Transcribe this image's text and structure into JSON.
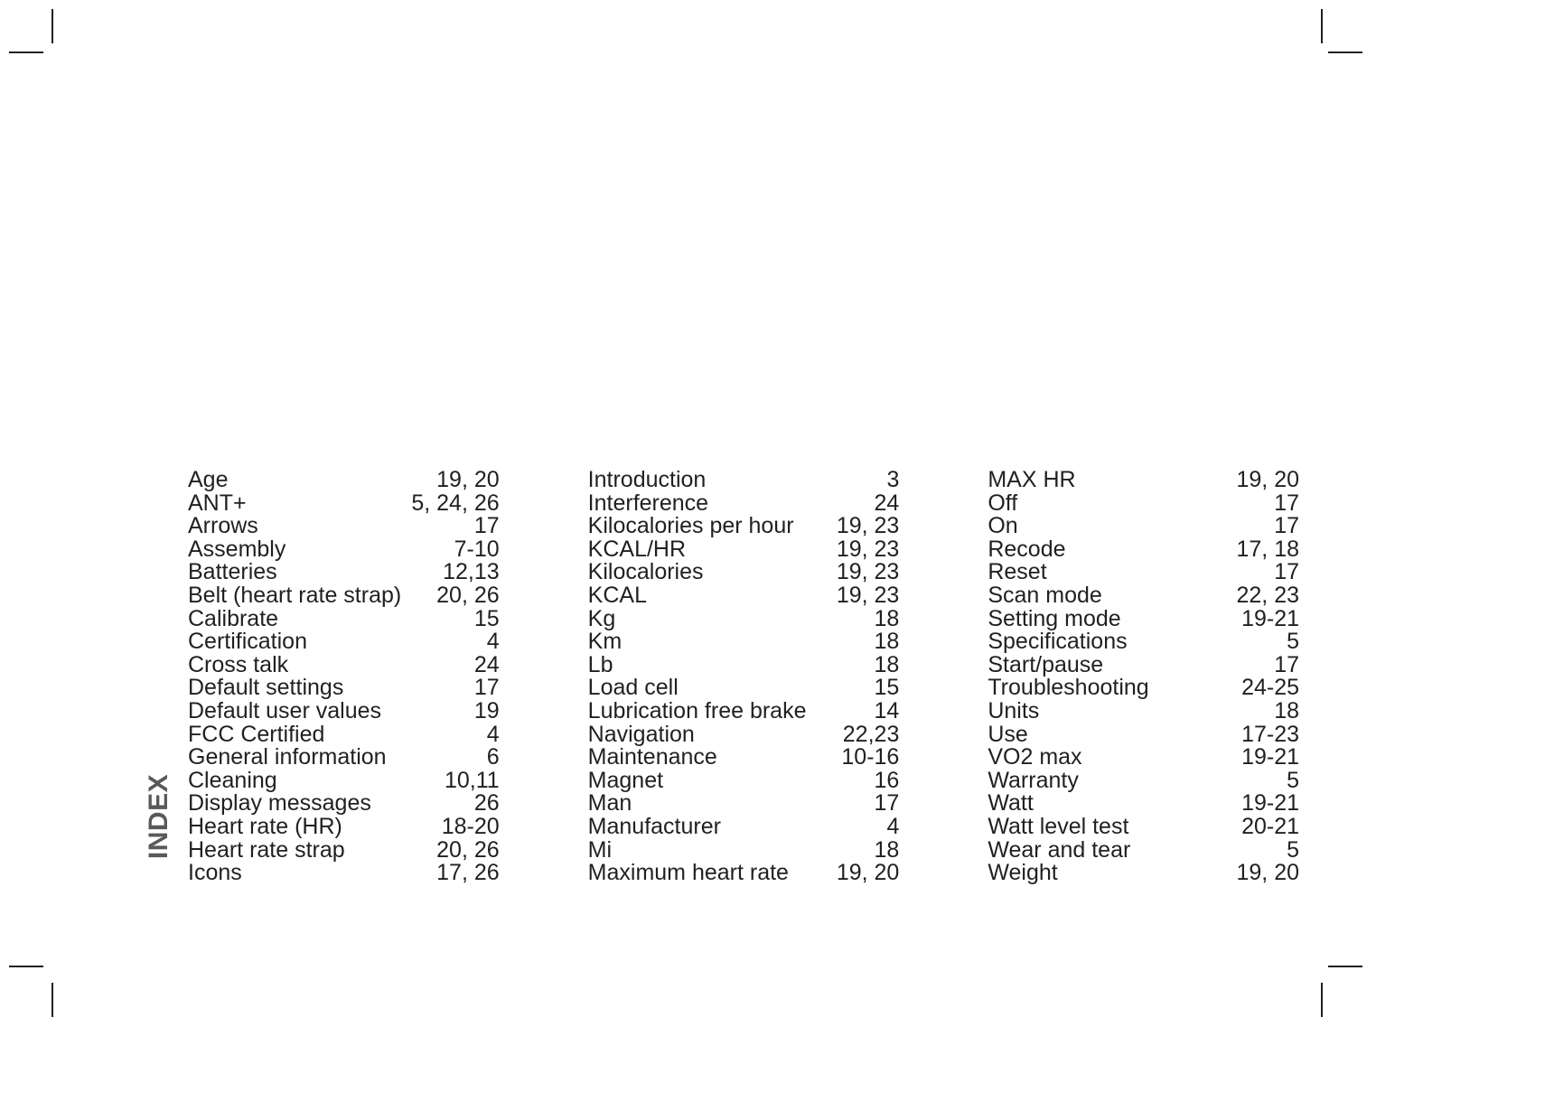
{
  "page": {
    "section_label": "INDEX",
    "section_label_color": "#58595b",
    "text_color": "#231f20",
    "background": "#ffffff"
  },
  "index": {
    "columns": [
      {
        "id": "column-1",
        "entries": [
          {
            "term": "Age",
            "pages": "19, 20"
          },
          {
            "term": "ANT+",
            "pages": "5, 24, 26"
          },
          {
            "term": "Arrows",
            "pages": "17"
          },
          {
            "term": "Assembly",
            "pages": "7-10"
          },
          {
            "term": "Batteries",
            "pages": "12,13"
          },
          {
            "term": "Belt (heart rate strap)",
            "pages": "20, 26"
          },
          {
            "term": "Calibrate",
            "pages": "15"
          },
          {
            "term": "Certification",
            "pages": "4"
          },
          {
            "term": "Cross talk",
            "pages": "24"
          },
          {
            "term": "Default settings",
            "pages": "17"
          },
          {
            "term": "Default user values",
            "pages": "19"
          },
          {
            "term": "FCC Certified",
            "pages": "4"
          },
          {
            "term": "General information",
            "pages": "6"
          },
          {
            "term": "Cleaning",
            "pages": "10,11"
          },
          {
            "term": "Display messages",
            "pages": "26"
          },
          {
            "term": "Heart rate (HR)",
            "pages": "18-20"
          },
          {
            "term": "Heart rate strap",
            "pages": "20, 26"
          },
          {
            "term": "Icons",
            "pages": "17, 26"
          }
        ]
      },
      {
        "id": "column-2",
        "entries": [
          {
            "term": "Introduction",
            "pages": "3"
          },
          {
            "term": "Interference",
            "pages": "24"
          },
          {
            "term": "Kilocalories per hour",
            "pages": "19, 23"
          },
          {
            "term": "KCAL/HR",
            "pages": "19, 23"
          },
          {
            "term": "Kilocalories",
            "pages": "19, 23"
          },
          {
            "term": "KCAL",
            "pages": "19, 23"
          },
          {
            "term": "Kg",
            "pages": "18"
          },
          {
            "term": "Km",
            "pages": "18"
          },
          {
            "term": "Lb",
            "pages": "18"
          },
          {
            "term": "Load cell",
            "pages": "15"
          },
          {
            "term": "Lubrication free brake",
            "pages": "14"
          },
          {
            "term": "Navigation",
            "pages": "22,23"
          },
          {
            "term": "Maintenance",
            "pages": "10-16"
          },
          {
            "term": "Magnet",
            "pages": "16"
          },
          {
            "term": "Man",
            "pages": "17"
          },
          {
            "term": "Manufacturer",
            "pages": "4"
          },
          {
            "term": "Mi",
            "pages": "18"
          },
          {
            "term": "Maximum heart rate",
            "pages": "19, 20"
          }
        ]
      },
      {
        "id": "column-3",
        "entries": [
          {
            "term": "MAX HR",
            "pages": "19, 20"
          },
          {
            "term": "Off",
            "pages": "17"
          },
          {
            "term": "On",
            "pages": "17"
          },
          {
            "term": "Recode",
            "pages": "17, 18"
          },
          {
            "term": "Reset",
            "pages": "17"
          },
          {
            "term": "Scan mode",
            "pages": "22, 23"
          },
          {
            "term": "Setting mode",
            "pages": "19-21"
          },
          {
            "term": "Specifications",
            "pages": "5"
          },
          {
            "term": "Start/pause",
            "pages": "17"
          },
          {
            "term": "Troubleshooting",
            "pages": "24-25"
          },
          {
            "term": "Units",
            "pages": "18"
          },
          {
            "term": "Use",
            "pages": "17-23"
          },
          {
            "term": "VO2 max",
            "pages": "19-21"
          },
          {
            "term": "Warranty",
            "pages": "5"
          },
          {
            "term": "Watt",
            "pages": "19-21"
          },
          {
            "term": "Watt level test",
            "pages": "20-21"
          },
          {
            "term": "Wear and tear",
            "pages": "5"
          },
          {
            "term": "Weight",
            "pages": "19, 20"
          }
        ]
      }
    ]
  }
}
